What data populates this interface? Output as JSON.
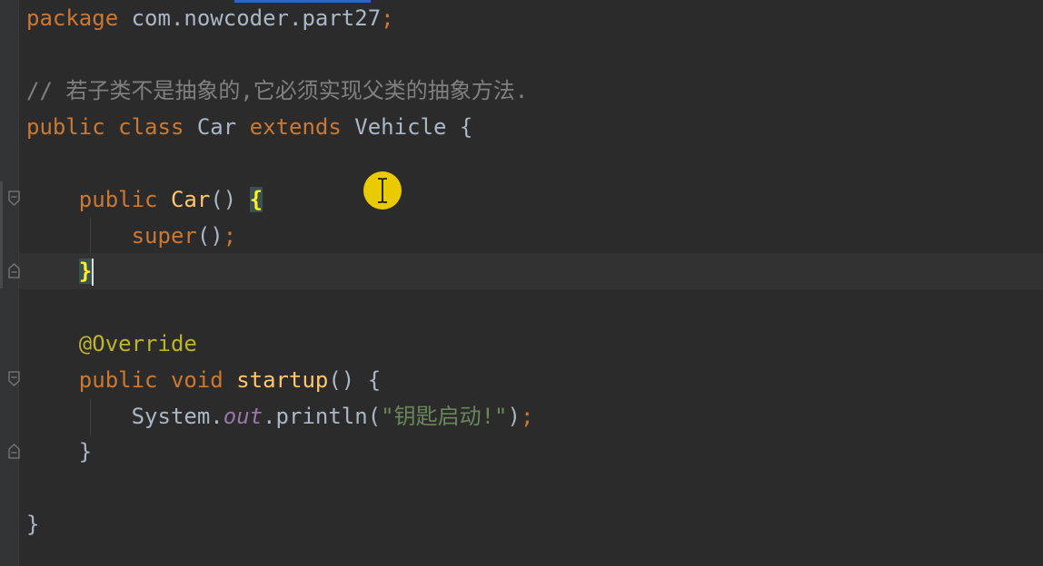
{
  "editor": {
    "colors": {
      "background": "#2b2b2b",
      "keyword": "#cc7832",
      "plain": "#a9b7c6",
      "method": "#ffc66d",
      "annotation": "#bbb529",
      "string": "#6a8759",
      "field": "#9876aa",
      "comment": "#808080",
      "current_line": "#323232"
    },
    "lines": {
      "l1": {
        "kw": "package",
        "rest": " com.nowcoder.part27",
        "semi": ";"
      },
      "l3": {
        "comment": "// 若子类不是抽象的,它必须实现父类的抽象方法."
      },
      "l4": {
        "kw1": "public",
        "kw2": "class",
        "name": "Car",
        "kw3": "extends",
        "parent": "Vehicle",
        "brace": "{"
      },
      "l6": {
        "kw": "public",
        "name": "Car",
        "parens": "()",
        "brace": "{"
      },
      "l7": {
        "kw": "super",
        "parens": "()",
        "semi": ";"
      },
      "l8": {
        "brace": "}"
      },
      "l10": {
        "annotation": "@Override"
      },
      "l11": {
        "kw1": "public",
        "kw2": "void",
        "name": "startup",
        "parens": "()",
        "brace": "{"
      },
      "l12": {
        "obj": "System.",
        "field": "out",
        "call": ".println(",
        "str": "\"钥匙启动!\"",
        "close": ")",
        "semi": ";"
      },
      "l13": {
        "brace": "}"
      },
      "l15": {
        "brace": "}"
      }
    },
    "cursor_icon": "text-ibeam-cursor-icon",
    "fold_icon": "fold-marker-icon"
  }
}
